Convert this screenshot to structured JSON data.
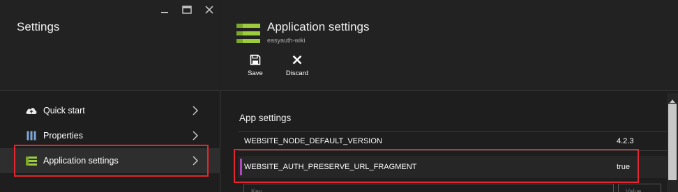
{
  "left_blade": {
    "title": "Settings",
    "window_controls": [
      "minimize-icon",
      "maximize-icon",
      "close-icon"
    ],
    "menu": [
      {
        "label": "Quick start",
        "icon": "cloud-icon"
      },
      {
        "label": "Properties",
        "icon": "properties-icon"
      },
      {
        "label": "Application settings",
        "icon": "app-settings-icon",
        "active": true
      }
    ]
  },
  "right_blade": {
    "title": "Application settings",
    "subtitle": "easyauth-wiki",
    "icon": "app-settings-icon",
    "commands": [
      {
        "label": "Save",
        "icon": "save-icon"
      },
      {
        "label": "Discard",
        "icon": "discard-x-icon"
      }
    ],
    "section_title": "App settings",
    "settings": [
      {
        "key": "WEBSITE_NODE_DEFAULT_VERSION",
        "value": "4.2.3"
      },
      {
        "key": "WEBSITE_AUTH_PRESERVE_URL_FRAGMENT",
        "value": "true"
      }
    ],
    "new_setting": {
      "key_placeholder": "Key",
      "value_placeholder": "Value"
    }
  },
  "colors": {
    "background": "#1e1e1e",
    "header_background": "#222222",
    "highlight_border": "#e5262e",
    "icon_green": "#9ccc3c",
    "row_accent": "#b146c2"
  }
}
